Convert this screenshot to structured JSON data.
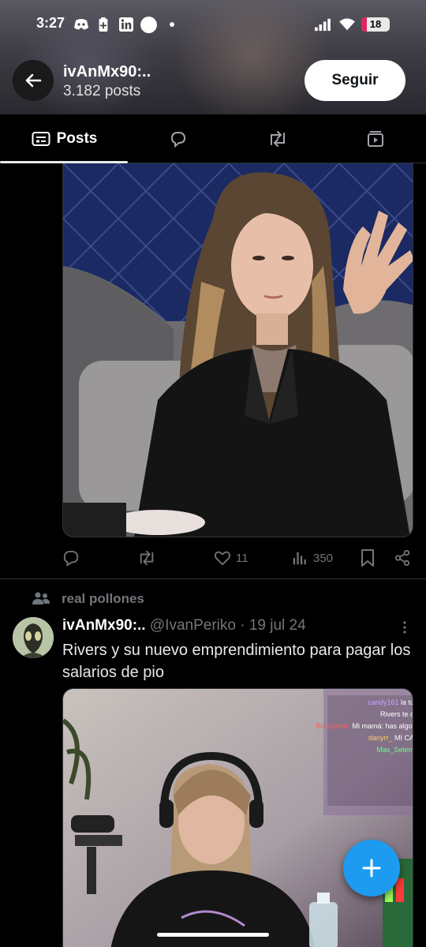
{
  "status_bar": {
    "time": "3:27",
    "battery": "18",
    "icons": [
      "discord-icon",
      "battery-saver-icon",
      "linkedin-icon",
      "circle-icon",
      "dot-icon",
      "signal-icon",
      "wifi-icon"
    ]
  },
  "header": {
    "profile_name": "ivAnMx90:..",
    "post_count": "3.182 posts",
    "follow_label": "Seguir"
  },
  "tabs": [
    {
      "label": "Posts",
      "icon": "posts-icon",
      "active": true
    },
    {
      "label": "",
      "icon": "replies-icon"
    },
    {
      "label": "",
      "icon": "reposts-icon"
    },
    {
      "label": "",
      "icon": "media-icon"
    }
  ],
  "post1": {
    "actions": {
      "replies": "",
      "reposts": "",
      "likes": "11",
      "views": "350"
    }
  },
  "post2": {
    "repost_label": "real pollones",
    "author_name": "ivAnMx90:..",
    "handle": "@IvanPeriko",
    "date": "· 19 jul 24",
    "text": "Rivers y su nuevo emprendimiento para pagar los salarios de pio",
    "chat_lines": [
      {
        "user": "candy161",
        "msg": "la tu",
        "color": "#c9a6ff"
      },
      {
        "user": "",
        "msg": "Rivers te q",
        "color": "#9fb7ff"
      },
      {
        "user": "Boddymar:",
        "msg": "Mi mamá: has algo,",
        "color": "#ff5a5a"
      },
      {
        "user": "danyrr_",
        "msg": "MI CA",
        "color": "#ffcc66"
      },
      {
        "user": "Max_Selem",
        "msg": "",
        "color": "#66ff88"
      }
    ]
  },
  "colors": {
    "accent": "#1d9bf0",
    "background": "#000000",
    "muted": "#71767b"
  }
}
